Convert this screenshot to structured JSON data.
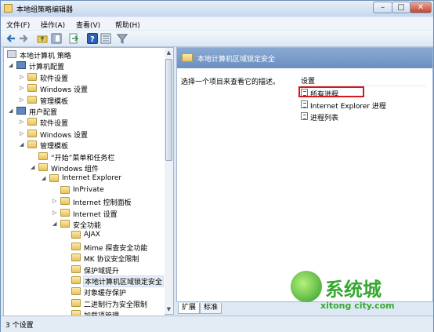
{
  "window": {
    "title": "本地组策略编辑器",
    "min": "–",
    "max": "□",
    "close": "✕"
  },
  "menu": [
    "文件(F)",
    "操作(A)",
    "查看(V)",
    "帮助(H)"
  ],
  "toolbar_icons": [
    "back-icon",
    "forward-icon",
    "up-folder-icon",
    "show-tree-icon",
    "export-icon",
    "help-icon",
    "properties-icon",
    "filter-icon"
  ],
  "tree": [
    {
      "label": "本地计算机 策略",
      "type": "root",
      "expand": ""
    },
    {
      "label": "计算机配置",
      "type": "pc",
      "expand": "◢"
    },
    {
      "label": "软件设置",
      "type": "folder",
      "expand": "▷"
    },
    {
      "label": "Windows 设置",
      "type": "folder",
      "expand": "▷"
    },
    {
      "label": "管理模板",
      "type": "folder",
      "expand": "▷"
    },
    {
      "label": "用户配置",
      "type": "pc",
      "expand": "◢"
    },
    {
      "label": "软件设置",
      "type": "folder",
      "expand": "▷"
    },
    {
      "label": "Windows 设置",
      "type": "folder",
      "expand": "▷"
    },
    {
      "label": "管理模板",
      "type": "folder",
      "expand": "◢"
    },
    {
      "label": "“开始”菜单和任务栏",
      "type": "folder",
      "expand": ""
    },
    {
      "label": "Windows 组件",
      "type": "folder",
      "expand": "◢"
    },
    {
      "label": "Internet Explorer",
      "type": "folder",
      "expand": "◢"
    },
    {
      "label": "InPrivate",
      "type": "folder",
      "expand": ""
    },
    {
      "label": "Internet 控制面板",
      "type": "folder",
      "expand": "▷"
    },
    {
      "label": "Internet 设置",
      "type": "folder",
      "expand": "▷"
    },
    {
      "label": "安全功能",
      "type": "folder",
      "expand": "◢"
    },
    {
      "label": "AJAX",
      "type": "folder",
      "expand": ""
    },
    {
      "label": "Mime 探查安全功能",
      "type": "folder",
      "expand": ""
    },
    {
      "label": "MK 协议安全限制",
      "type": "folder",
      "expand": ""
    },
    {
      "label": "保护域提升",
      "type": "folder",
      "expand": ""
    },
    {
      "label": "本地计算机区域锁定安全",
      "type": "folder",
      "expand": "",
      "selected": true
    },
    {
      "label": "对象缓存保护",
      "type": "folder",
      "expand": ""
    },
    {
      "label": "二进制行为安全限制",
      "type": "folder",
      "expand": ""
    },
    {
      "label": "加载项管理",
      "type": "folder",
      "expand": ""
    }
  ],
  "right": {
    "header": "本地计算机区域锁定安全",
    "description": "选择一个项目来查看它的描述。",
    "column_header": "设置",
    "items": [
      "所有进程",
      "Internet Explorer 进程",
      "进程列表"
    ]
  },
  "tabs": [
    "扩展",
    "标准"
  ],
  "status": "3 个设置",
  "watermark": {
    "text": "系统城",
    "sub": "xitong city.com"
  }
}
